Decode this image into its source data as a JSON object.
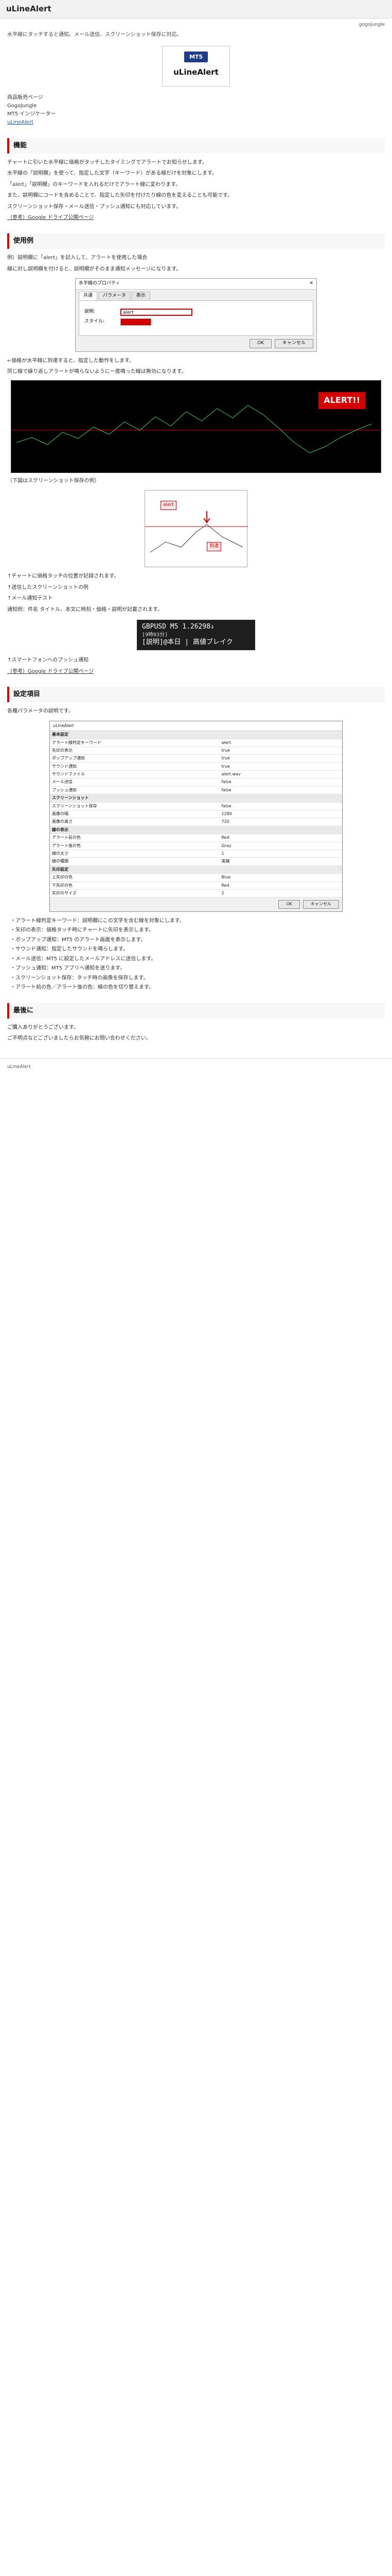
{
  "header": {
    "site_title": "uLineAlert"
  },
  "meta": {
    "date": "gogojungle",
    "lead": "水平線にタッチすると通知。メール送信、スクリーンショット保存に対応。"
  },
  "logo": {
    "badge": "MT5",
    "name": "uLineAlert"
  },
  "info": {
    "l1": "商品販売ページ",
    "l2": "GogoJungle",
    "l3": "MT5 インジケーター",
    "link": "uLineAlert"
  },
  "sections": {
    "feature": "機能",
    "usage": "使用例",
    "settings": "設定項目",
    "last": "最後に"
  },
  "texts": {
    "feature_p1": "チャートに引いた水平線に価格がタッチしたタイミングでアラートでお知らせします。",
    "feature_p2": "水平線の「説明欄」を使って、指定した文字（キーワード）がある線だけを対象にします。",
    "feature_p3": "「alert」「説明欄」のキーワードを入れるだけでアラート線に変わります。",
    "feature_p4": "また、説明欄にコードを含めることで、指定した矢印を付けたり線の色を変えることも可能です。",
    "feature_p5": "スクリーンショット保存・メール送信・プッシュ通知にも対応しています。",
    "feature_note": "（参考）Google ドライブ公開ページ",
    "usage_p1": "例）説明欄に「alert」を記入して、アラートを使用した場合",
    "usage_p2": "線に対し説明欄を付けると、説明欄がそのまま通知メッセージになります。",
    "usage_p3": "←価格が水平線に到達すると、指定した動作をします。",
    "usage_p4": "同じ線で繰り返しアラートが鳴らないように一度鳴った線は無効になります。",
    "usage_p5": "（下図はスクリーンショット保存の例）",
    "usage_p6": "↑チャートに価格タッチの位置が記録されます。",
    "usage_p7": "↑送信したスクリーンショットの例",
    "usage_p8": "↑メール通知テスト",
    "usage_p9": "通知例：件名 タイトル、本文に時刻・価格・説明が記載されます。",
    "usage_p10": "↑スマートフォンへのプッシュ通知",
    "usage_p11": "（参考）Google ドライブ公開ページ",
    "settings_p1": "各種パラメータの説明です。",
    "last_p1": "ご購入ありがとうございます。",
    "last_p2": "ご不明点などございましたらお気軽にお問い合わせください。",
    "footer": "uLineAlert"
  },
  "dialog": {
    "title": "水平線のプロパティ",
    "tabs": [
      "共通",
      "パラメータ",
      "表示"
    ],
    "desc_label": "説明:",
    "desc_value": "alert",
    "style_label": "スタイル:",
    "ok": "OK",
    "cancel": "キャンセル"
  },
  "chart": {
    "alert_text": "ALERT!!"
  },
  "zoom": {
    "tag1": "alert",
    "tag2": "到達"
  },
  "notify": {
    "line1": "GBPUSD M5 1.26298↓",
    "line2": "[9時03分]",
    "line3": "[説明]@本日 | 高値ブレイク"
  },
  "settings_rows": [
    {
      "k": "基本設定",
      "v": "",
      "sect": true
    },
    {
      "k": "アラート線判定キーワード",
      "v": "alert",
      "sect": false
    },
    {
      "k": "矢印の表示",
      "v": "true",
      "sect": false
    },
    {
      "k": "ポップアップ通知",
      "v": "true",
      "sect": false
    },
    {
      "k": "サウンド通知",
      "v": "true",
      "sect": false
    },
    {
      "k": "サウンドファイル",
      "v": "alert.wav",
      "sect": false
    },
    {
      "k": "メール送信",
      "v": "false",
      "sect": false
    },
    {
      "k": "プッシュ通知",
      "v": "false",
      "sect": false
    },
    {
      "k": "スクリーンショット",
      "v": "",
      "sect": true
    },
    {
      "k": "スクリーンショット保存",
      "v": "false",
      "sect": false
    },
    {
      "k": "画像の幅",
      "v": "1280",
      "sect": false
    },
    {
      "k": "画像の高さ",
      "v": "720",
      "sect": false
    },
    {
      "k": "線の表示",
      "v": "",
      "sect": true
    },
    {
      "k": "アラート前の色",
      "v": "Red",
      "sect": false
    },
    {
      "k": "アラート後の色",
      "v": "Gray",
      "sect": false
    },
    {
      "k": "線の太さ",
      "v": "1",
      "sect": false
    },
    {
      "k": "線の種類",
      "v": "実線",
      "sect": false
    },
    {
      "k": "矢印設定",
      "v": "",
      "sect": true
    },
    {
      "k": "上矢印の色",
      "v": "Blue",
      "sect": false
    },
    {
      "k": "下矢印の色",
      "v": "Red",
      "sect": false
    },
    {
      "k": "矢印のサイズ",
      "v": "2",
      "sect": false
    }
  ],
  "param_items": [
    "アラート線判定キーワード：説明欄にこの文字を含む線を対象にします。",
    "矢印の表示：価格タッチ時にチャートに矢印を表示します。",
    "ポップアップ通知：MT5 のアラート画面を表示します。",
    "サウンド通知：指定したサウンドを鳴らします。",
    "メール送信：MT5 に設定したメールアドレスに送信します。",
    "プッシュ通知：MT5 アプリへ通知を送ります。",
    "スクリーンショット保存：タッチ時の画像を保存します。",
    "アラート前の色／アラート後の色：線の色を切り替えます。"
  ],
  "colors": {
    "accent": "#d40000",
    "link": "#1a5fb4",
    "logo_bg": "#1f3c88"
  }
}
